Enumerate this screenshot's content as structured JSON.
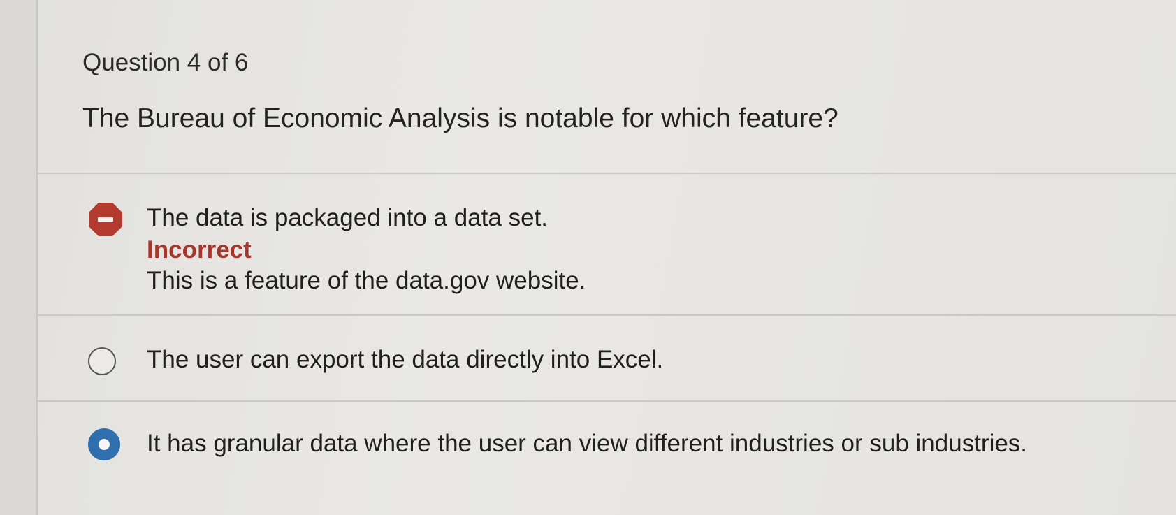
{
  "question": {
    "counter": "Question 4 of 6",
    "prompt": "The Bureau of Economic Analysis is notable for which feature?"
  },
  "options": [
    {
      "text": "The data is packaged into a data set.",
      "state": "incorrect",
      "feedback_status": "Incorrect",
      "feedback_text": "This is a feature of the data.gov website.",
      "icon": "incorrect-stop-icon"
    },
    {
      "text": "The user can export the data directly into Excel.",
      "state": "unselected",
      "icon": "radio-empty-icon"
    },
    {
      "text": "It has granular data where the user can view different industries or sub industries.",
      "state": "selected",
      "icon": "radio-selected-icon"
    }
  ],
  "colors": {
    "incorrect": "#b23a2e",
    "selected": "#2f6fae",
    "background": "#e8e7e3"
  }
}
